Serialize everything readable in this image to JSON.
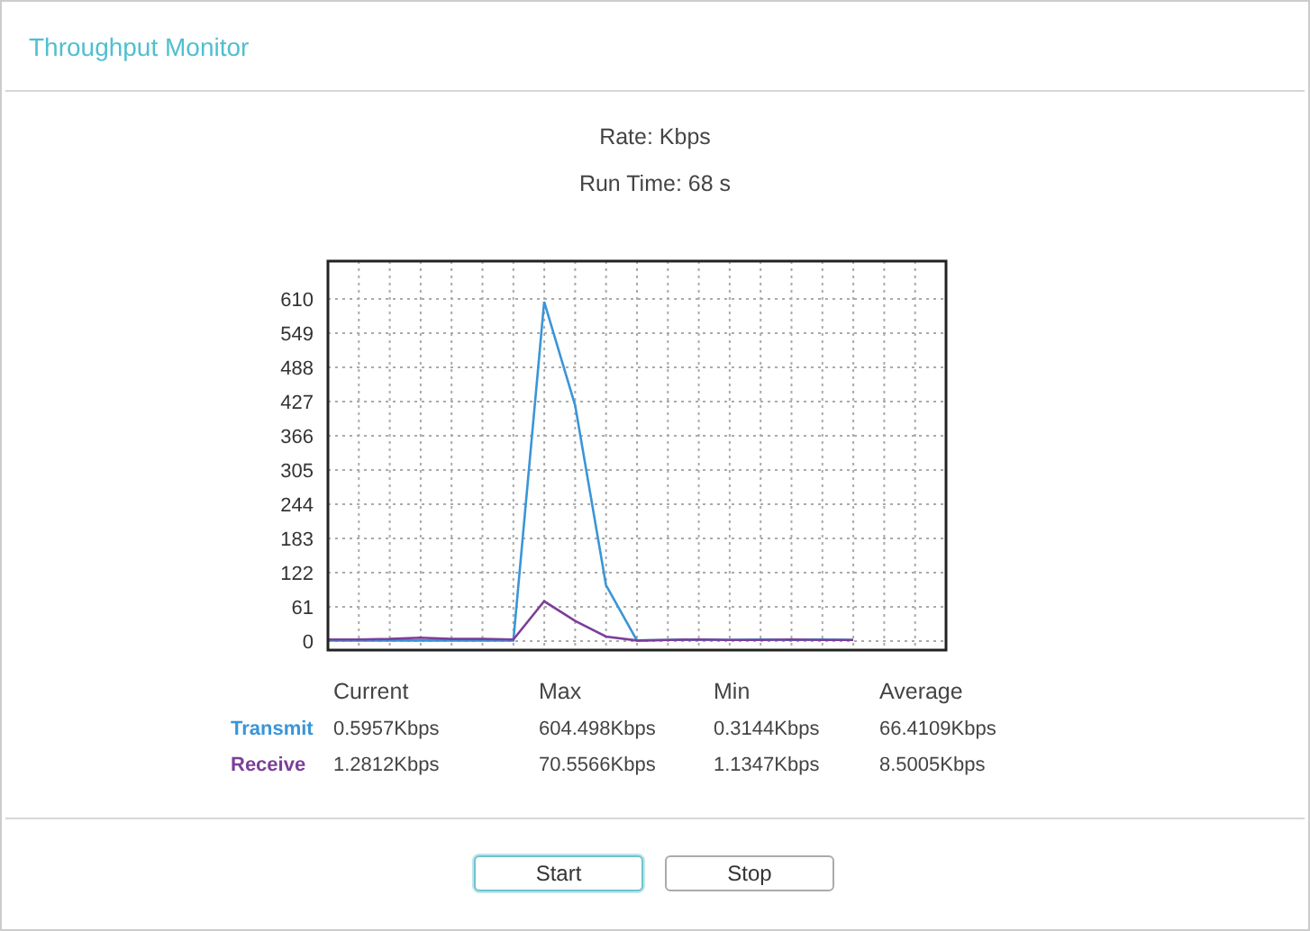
{
  "title": "Throughput Monitor",
  "rate": "Rate: Kbps",
  "run_time": "Run Time: 68 s",
  "chart": {
    "chart_data": {
      "type": "line",
      "grid": true,
      "ylim": [
        -16,
        610
      ],
      "yticks": [
        0,
        61,
        122,
        183,
        244,
        305,
        366,
        427,
        488,
        549,
        610
      ],
      "series": [
        {
          "name": "Transmit",
          "color": "#3a95d8",
          "values": [
            1,
            1,
            1,
            1,
            1,
            1,
            1,
            605,
            420,
            100,
            1,
            2,
            3,
            2,
            3,
            2,
            3,
            2
          ]
        },
        {
          "name": "Receive",
          "color": "#7b3f98",
          "values": [
            3,
            3,
            4,
            6,
            4,
            4,
            3,
            71,
            36,
            8,
            1,
            2,
            3,
            2,
            2,
            3,
            2,
            2
          ]
        }
      ]
    }
  },
  "stats": {
    "columns": [
      "Current",
      "Max",
      "Min",
      "Average"
    ],
    "rows": [
      {
        "cells": [
          "0.5957Kbps",
          "604.498Kbps",
          "0.3144Kbps",
          "66.4109Kbps"
        ]
      },
      {
        "cells": [
          "1.2812Kbps",
          "70.5566Kbps",
          "1.1347Kbps",
          "8.5005Kbps"
        ]
      }
    ]
  },
  "buttons": [
    {
      "label": "Start",
      "focused": true
    },
    {
      "label": "Stop",
      "focused": false
    }
  ]
}
